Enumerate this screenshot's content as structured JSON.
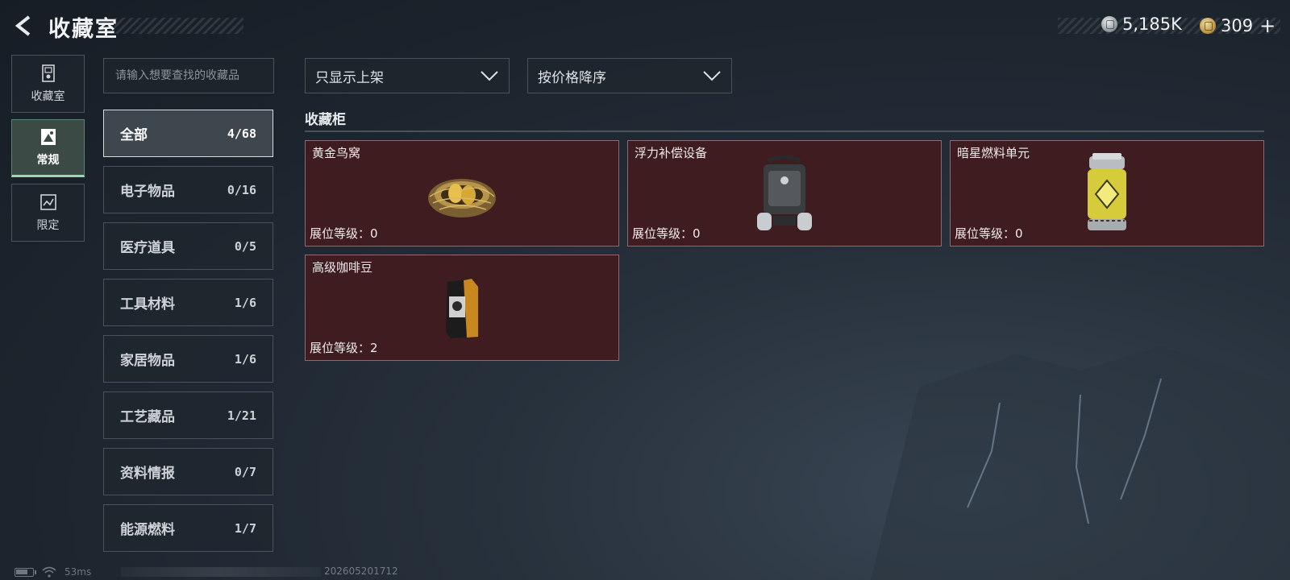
{
  "header": {
    "title": "收藏室",
    "currencies": [
      {
        "name": "silver",
        "value": "5,185K",
        "color": "#9aa2aa"
      },
      {
        "name": "gold",
        "value": "309",
        "color": "#c89a4a"
      }
    ],
    "plus_label": "+"
  },
  "side_nav": {
    "items": [
      {
        "label": "收藏室",
        "icon": "collection-room-icon",
        "active": false
      },
      {
        "label": "常规",
        "icon": "regular-icon",
        "active": true
      },
      {
        "label": "限定",
        "icon": "limited-icon",
        "active": false
      }
    ],
    "accent_color": "#9cd6b9"
  },
  "search": {
    "placeholder": "请输入想要查找的收藏品"
  },
  "categories": [
    {
      "name": "全部",
      "count": "4/68",
      "active": true
    },
    {
      "name": "电子物品",
      "count": "0/16"
    },
    {
      "name": "医疗道具",
      "count": "0/5"
    },
    {
      "name": "工具材料",
      "count": "1/6"
    },
    {
      "name": "家居物品",
      "count": "1/6"
    },
    {
      "name": "工艺藏品",
      "count": "1/21"
    },
    {
      "name": "资料情报",
      "count": "0/7"
    },
    {
      "name": "能源燃料",
      "count": "1/7"
    }
  ],
  "filters": {
    "shelf_filter": "只显示上架",
    "sort_order": "按价格降序"
  },
  "section": {
    "title": "收藏柜"
  },
  "items": [
    {
      "name": "黄金鸟窝",
      "level_text": "展位等级：0",
      "icon": "golden-nest-icon"
    },
    {
      "name": "浮力补偿设备",
      "level_text": "展位等级：0",
      "icon": "buoyancy-device-icon"
    },
    {
      "name": "暗星燃料单元",
      "level_text": "展位等级：0",
      "icon": "fuel-cell-icon"
    },
    {
      "name": "高级咖啡豆",
      "level_text": "展位等级：2",
      "icon": "coffee-bag-icon"
    }
  ],
  "card_color": "#3e1c1f",
  "status_bar": {
    "ping": "53ms",
    "build": "202605201712"
  }
}
